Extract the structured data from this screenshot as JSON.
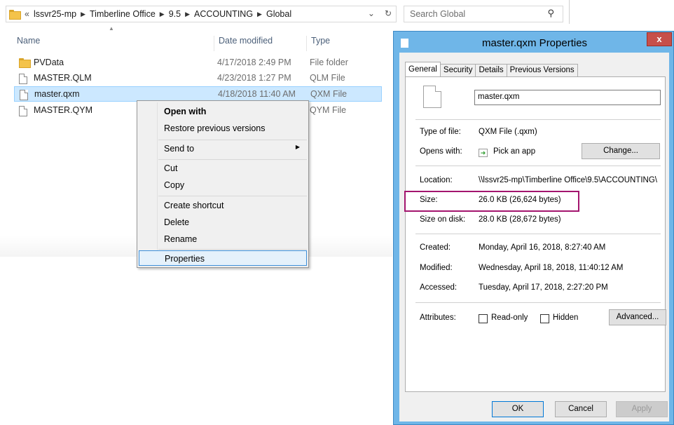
{
  "explorer": {
    "breadcrumb": [
      "lssvr25-mp",
      "Timberline Office",
      "9.5",
      "ACCOUNTING",
      "Global"
    ],
    "breadcrumb_prefix": "«",
    "search_placeholder": "Search Global",
    "columns": {
      "name": "Name",
      "date": "Date modified",
      "type": "Type"
    },
    "files": [
      {
        "name": "PVData",
        "date": "4/17/2018 2:49 PM",
        "type": "File folder",
        "icon": "folder-icon"
      },
      {
        "name": "MASTER.QLM",
        "date": "4/23/2018 1:27 PM",
        "type": "QLM File",
        "icon": "file-icon"
      },
      {
        "name": "master.qxm",
        "date": "4/18/2018 11:40 AM",
        "type": "QXM File",
        "icon": "file-icon",
        "selected": true
      },
      {
        "name": "MASTER.QYM",
        "date": "",
        "type": "QYM File",
        "icon": "file-icon"
      }
    ]
  },
  "context_menu": {
    "open_with": "Open with",
    "restore": "Restore previous versions",
    "send_to": "Send to",
    "cut": "Cut",
    "copy": "Copy",
    "create_shortcut": "Create shortcut",
    "delete": "Delete",
    "rename": "Rename",
    "properties": "Properties"
  },
  "dialog": {
    "title": "master.qxm Properties",
    "close": "x",
    "tabs": [
      "General",
      "Security",
      "Details",
      "Previous Versions"
    ],
    "filename": "master.qxm",
    "type_label": "Type of file:",
    "type_value": "QXM File (.qxm)",
    "opens_label": "Opens with:",
    "opens_value": "Pick an app",
    "change_button": "Change...",
    "location_label": "Location:",
    "location_value": "\\\\lssvr25-mp\\Timberline Office\\9.5\\ACCOUNTING\\",
    "size_label": "Size:",
    "size_value": "26.0 KB (26,624 bytes)",
    "size_on_disk_label": "Size on disk:",
    "size_on_disk_value": "28.0 KB (28,672 bytes)",
    "created_label": "Created:",
    "created_value": "Monday, April 16, 2018, 8:27:40 AM",
    "modified_label": "Modified:",
    "modified_value": "Wednesday, April 18, 2018, 11:40:12 AM",
    "accessed_label": "Accessed:",
    "accessed_value": "Tuesday, April 17, 2018, 2:27:20 PM",
    "attributes_label": "Attributes:",
    "readonly_label": "Read-only",
    "hidden_label": "Hidden",
    "advanced_button": "Advanced...",
    "ok": "OK",
    "cancel": "Cancel",
    "apply": "Apply"
  },
  "colors": {
    "highlight_box": "#a3156e",
    "selection": "#cce8ff",
    "dialog_frame": "#6fb6e8"
  }
}
